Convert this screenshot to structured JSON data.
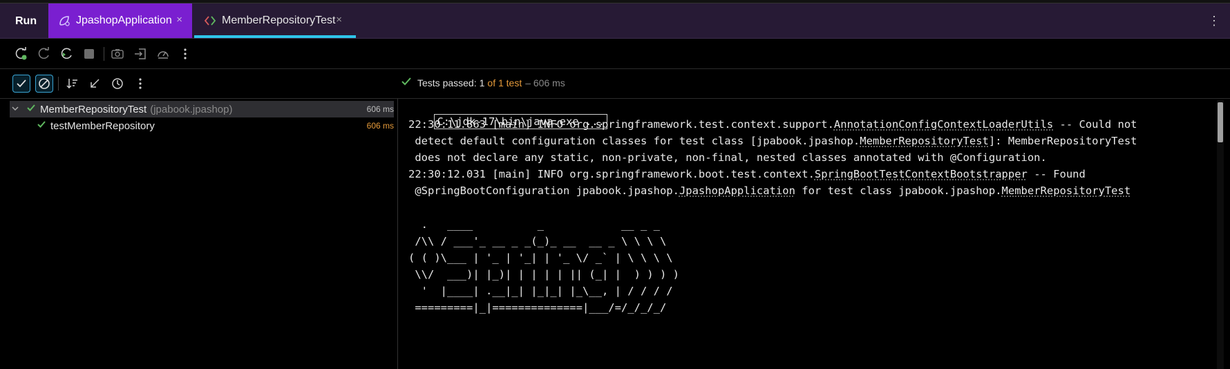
{
  "run_panel": {
    "title": "Run",
    "tabs": [
      {
        "label": "JpashopApplication",
        "icon": "spring-app-icon",
        "close": "×"
      },
      {
        "label": "MemberRepositoryTest",
        "icon": "junit-test-icon",
        "close": "×"
      }
    ],
    "more": "⋮"
  },
  "toolbar": {
    "icons": [
      "rerun-icon",
      "rerun-failed-icon",
      "rerun-auto-icon",
      "stop-icon",
      "screenshot-icon",
      "import-icon",
      "coverage-icon",
      "more-icon"
    ]
  },
  "filter_toolbar": {
    "icons": [
      "show-passed-icon",
      "show-ignored-icon",
      "sort-icon",
      "collapse-icon",
      "history-icon",
      "more-icon"
    ]
  },
  "status": {
    "label": "Tests passed:",
    "passed": "1",
    "of_text": "of 1 test",
    "duration": "– 606 ms"
  },
  "tree": [
    {
      "name": "MemberRepositoryTest",
      "package": "(jpabook.jpashop)",
      "time": "606 ms",
      "expanded": true
    },
    {
      "name": "testMemberRepository",
      "time": "606 ms"
    }
  ],
  "console": {
    "cmd": "C:\\jdk-17\\bin\\java.exe ...",
    "log1": {
      "prefix": "22:30:11.863 [main] INFO org.springframework.test.context.support.",
      "cls": "AnnotationConfigContextLoaderUtils",
      "suffix": " -- Could not",
      "l2a": " detect default configuration classes for test class [jpabook.jpashop.",
      "l2cls": "MemberRepositoryTest",
      "l2b": "]: MemberRepositoryTest",
      "l3": " does not declare any static, non-private, non-final, nested classes annotated with @Configuration."
    },
    "log2": {
      "prefix": "22:30:12.031 [main] INFO org.springframework.boot.test.context.",
      "cls": "SpringBootTestContextBootstrapper",
      "suffix": " -- Found",
      "l2a": " @SpringBootConfiguration jpabook.jpashop.",
      "l2cls": "JpashopApplication",
      "l2b": " for test class jpabook.jpashop.",
      "l2cls2": "MemberRepositoryTest"
    },
    "banner": [
      "  .   ____          _            __ _ _",
      " /\\\\ / ___'_ __ _ _(_)_ __  __ _ \\ \\ \\ \\",
      "( ( )\\___ | '_ | '_| | '_ \\/ _` | \\ \\ \\ \\",
      " \\\\/  ___)| |_)| | | | | || (_| |  ) ) ) )",
      "  '  |____| .__|_| |_|_| |_\\__, | / / / /",
      " =========|_|==============|___/=/_/_/_/"
    ]
  },
  "colors": {
    "tabbar_bg": "#271a35",
    "active_app_tab": "#7a1fd0",
    "selected_tab_underline": "#2ec5ea",
    "pass_green": "#5fb85f",
    "orange": "#e59a3a"
  }
}
